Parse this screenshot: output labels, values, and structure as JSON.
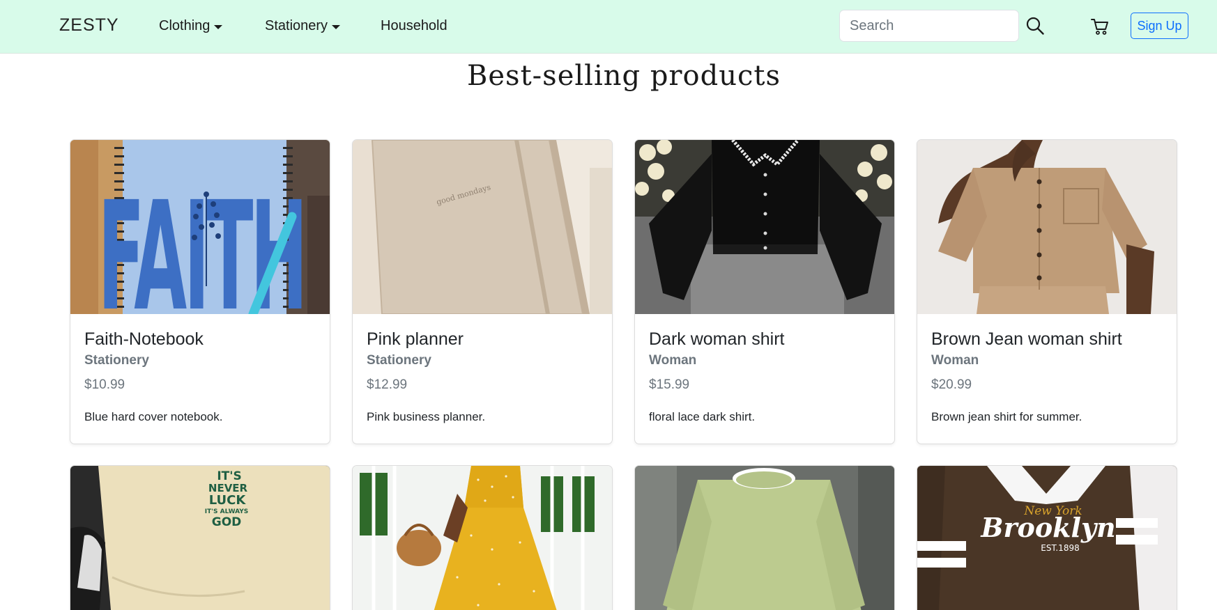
{
  "nav": {
    "brand": "ZESTY",
    "items": [
      {
        "label": "Clothing",
        "dropdown": true
      },
      {
        "label": "Stationery",
        "dropdown": true
      },
      {
        "label": "Household",
        "dropdown": false
      }
    ],
    "search_placeholder": "Search",
    "search_icon": "search-icon",
    "cart_icon": "cart-icon",
    "signup_label": "Sign Up"
  },
  "colors": {
    "navbar_bg": "#d8fbea",
    "accent": "#0d6efd",
    "muted": "#6c757d"
  },
  "section": {
    "title": "Best-selling products"
  },
  "products": [
    {
      "title": "Faith-Notebook",
      "category": "Stationery",
      "price": "$10.99",
      "description": "Blue hard cover notebook."
    },
    {
      "title": "Pink planner",
      "category": "Stationery",
      "price": "$12.99",
      "description": "Pink business planner."
    },
    {
      "title": "Dark woman shirt",
      "category": "Woman",
      "price": "$15.99",
      "description": "floral lace dark shirt."
    },
    {
      "title": "Brown Jean woman shirt",
      "category": "Woman",
      "price": "$20.99",
      "description": "Brown jean shirt for summer."
    }
  ],
  "image_text": {
    "faith": "FAITH",
    "planner": "good mondays",
    "tshirt_print": [
      "IT'S",
      "NEVER",
      "LUCK",
      "IT'S ALWAYS",
      "GOD"
    ],
    "brooklyn": [
      "New York",
      "Brooklyn",
      "EST.1898"
    ]
  }
}
